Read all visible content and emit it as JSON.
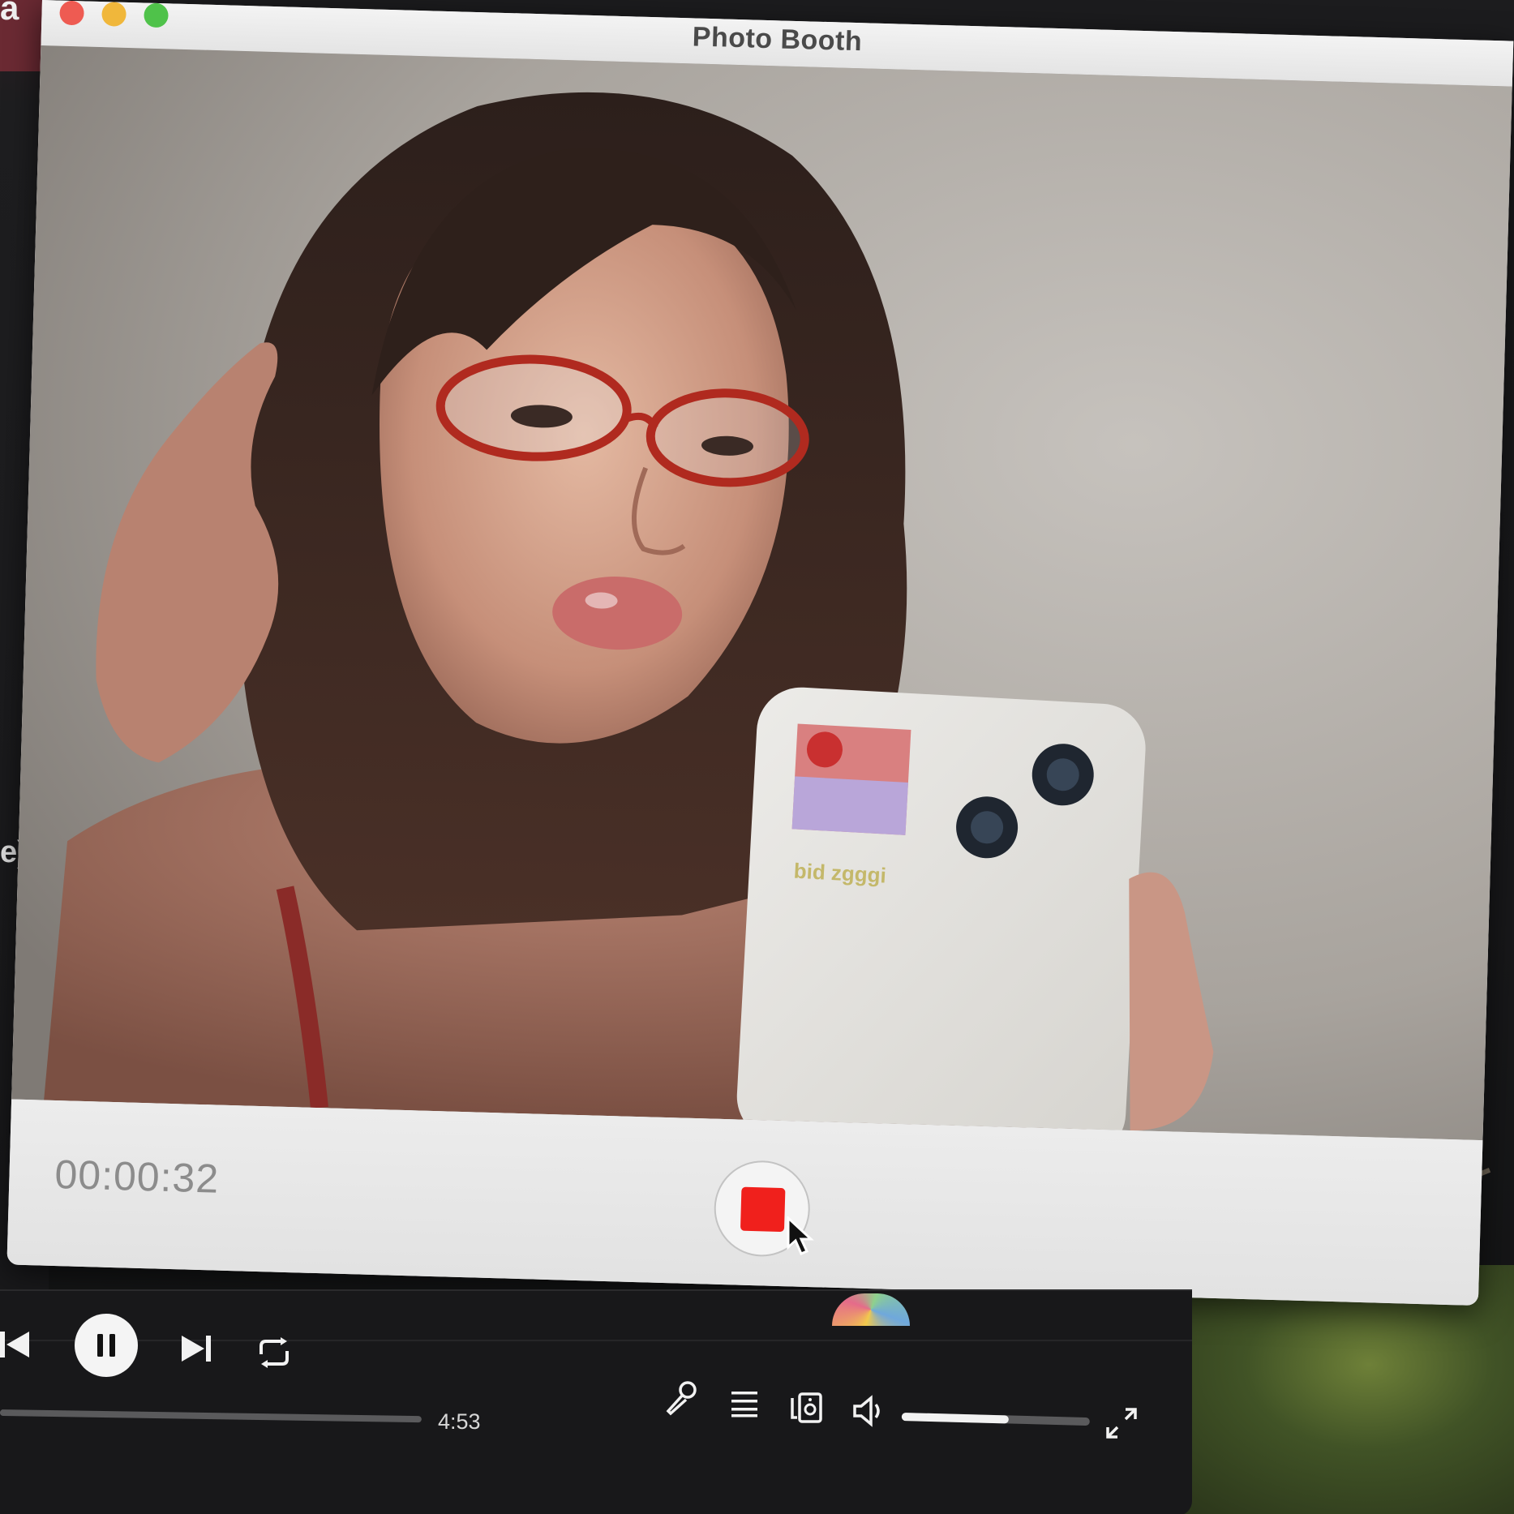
{
  "photo_booth": {
    "title": "Photo Booth",
    "recording_elapsed": "00:00:32",
    "stop_button_color": "#f0201c",
    "phone_case_text": "bid zgggi"
  },
  "background_app": {
    "visible_letter": "a",
    "visible_text": "e)"
  },
  "music_player": {
    "track_duration": "4:53",
    "volume_level": 0.57,
    "icons": [
      "previous-icon",
      "pause-icon",
      "next-icon",
      "repeat-icon",
      "microphone-icon",
      "queue-icon",
      "connect-devices-icon",
      "volume-icon",
      "fullscreen-icon"
    ]
  }
}
